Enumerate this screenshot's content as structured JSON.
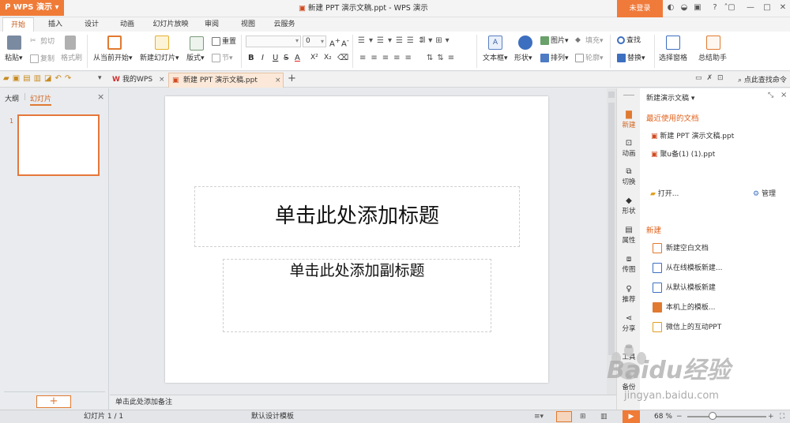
{
  "app": {
    "name": "WPS 演示",
    "window_title": "新建 PPT 演示文稿.ppt - WPS 演示",
    "login": "未登录"
  },
  "menu": {
    "tabs": [
      "开始",
      "插入",
      "设计",
      "动画",
      "幻灯片放映",
      "审阅",
      "视图",
      "云服务"
    ],
    "active": "开始"
  },
  "ribbon": {
    "paste": "粘贴",
    "cut": "剪切",
    "copy": "复制",
    "format_painter": "格式刷",
    "from_current": "从当前开始",
    "new_slide": "新建幻灯片",
    "layout": "版式",
    "reset": "重置",
    "section": "节",
    "font_size": "0",
    "font_buttons": [
      "B",
      "I",
      "U",
      "S",
      "A",
      "X²",
      "X₂"
    ],
    "textbox": "文本框",
    "shape": "形状",
    "picture": "图片",
    "fill": "填充",
    "arrange": "排列",
    "outline": "轮廓",
    "find": "查找",
    "replace": "替换",
    "select_pane": "选择窗格",
    "summary_assistant": "总结助手"
  },
  "tabs": {
    "docs": [
      {
        "label": "我的WPS"
      },
      {
        "label": "新建 PPT 演示文稿.ppt"
      }
    ],
    "search": "点此查找命令"
  },
  "left_panel": {
    "tabs": [
      "大纲",
      "幻灯片"
    ],
    "active": "幻灯片",
    "slide_number": "1"
  },
  "slide": {
    "title_placeholder": "单击此处添加标题",
    "subtitle_placeholder": "单击此处添加副标题"
  },
  "notes": "单击此处添加备注",
  "side_tabs": [
    "新建",
    "动画",
    "切换",
    "形状",
    "属性",
    "传图",
    "推荐",
    "分享",
    "工具",
    "备份"
  ],
  "task_pane": {
    "header": "新建演示文稿",
    "recent_title": "最近使用的文档",
    "recent": [
      "新建 PPT 演示文稿.ppt",
      "聚u备(1) (1).ppt"
    ],
    "open": "打开...",
    "manage": "管理",
    "new_title": "新建",
    "new_items": [
      "新建空白文档",
      "从在线模板新建...",
      "从默认模板新建",
      "本机上的模板...",
      "微信上的互动PPT"
    ]
  },
  "status": {
    "slide_info": "幻灯片 1 / 1",
    "template": "默认设计模板",
    "zoom": "68 %"
  },
  "watermark": {
    "brand": "Baidu经验",
    "url": "jingyan.baidu.com"
  },
  "colors": {
    "accent": "#ef7b37",
    "active_tab_text": "#c85a1a",
    "section_title": "#e0621c"
  }
}
